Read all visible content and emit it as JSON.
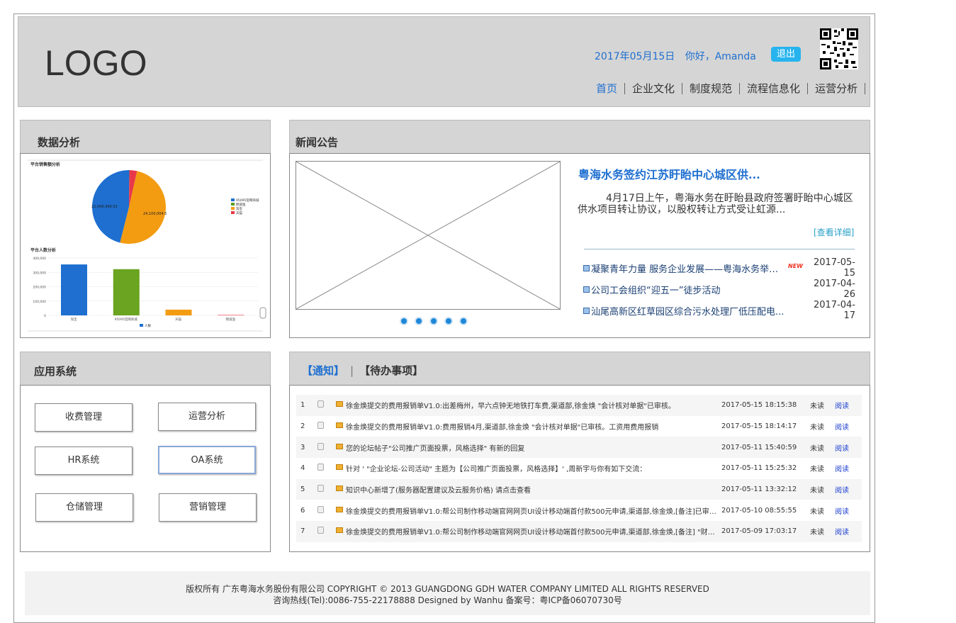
{
  "header": {
    "logo": "LOGO",
    "date": "2017年05月15日",
    "greeting": "你好，Amanda",
    "logout": "退出",
    "nav": [
      "首页",
      "企业文化",
      "制度规范",
      "流程信息化",
      "运营分析"
    ]
  },
  "data_panel": {
    "title": "数据分析",
    "pie": {
      "title": "平台销售额分析",
      "label_a": "22,099,999.53",
      "label_b": "24,100,004.5",
      "legend": [
        "95095官网商城",
        "明道渔",
        "淘宝",
        "天猫"
      ],
      "colors": [
        "#1e6fd0",
        "#5a9e1f",
        "#f39c12",
        "#e8394a"
      ]
    },
    "bar": {
      "title": "平台人数分析",
      "yticks": [
        "400,000",
        "300,000",
        "200,000",
        "100,000",
        "0"
      ],
      "categories": [
        "淘宝",
        "95095官网商城",
        "天猫",
        "明道渔"
      ],
      "legend": "人数"
    }
  },
  "chart_data": [
    {
      "type": "pie",
      "title": "平台销售额分析",
      "labels": [
        "95095官网商城",
        "明道渔",
        "淘宝",
        "天猫"
      ],
      "values": [
        22099999.53,
        0,
        24100004.5,
        1600000
      ]
    },
    {
      "type": "bar",
      "title": "平台人数分析",
      "categories": [
        "淘宝",
        "95095官网商城",
        "天猫",
        "明道渔"
      ],
      "values": [
        355000,
        322000,
        40000,
        3000
      ],
      "ylim": [
        0,
        400000
      ],
      "legend": [
        "人数"
      ]
    }
  ],
  "news": {
    "title": "新闻公告",
    "headline": "粤海水务签约江苏盱眙中心城区供...",
    "summary": "4月17日上午，粤海水务在盱眙县政府签署盱眙中心城区供水项目转让协议，以股权转让方式受让虹源...",
    "more": "[查看详细]",
    "items": [
      {
        "text": "凝聚青年力量 服务企业发展——粤海水务举办“...",
        "badge": "NEW",
        "date": "2017-05-15"
      },
      {
        "text": "公司工会组织“迎五一”徒步活动",
        "badge": "",
        "date": "2017-04-26"
      },
      {
        "text": "汕尾高新区红草园区综合污水处理厂低压配电...",
        "badge": "",
        "date": "2017-04-17"
      }
    ]
  },
  "apps": {
    "title": "应用系统",
    "buttons": [
      "收费管理",
      "运营分析",
      "HR系统",
      "OA系统",
      "仓储管理",
      "营销管理"
    ]
  },
  "notices": {
    "tab_notice": "【通知】",
    "tab_todo": "【待办事项】",
    "rows": [
      {
        "no": "1",
        "title": "徐金焕提交的费用报销单V1.0:出差梅州，早六点钟无地铁打车费,渠道部,徐金焕 \"会计核对单据\"已审核。",
        "time": "2017-05-15 18:15:38",
        "status": "未读",
        "action": "阅读"
      },
      {
        "no": "2",
        "title": "徐金焕提交的费用报销单V1.0:费用报销4月,渠道部,徐金焕 \"会计核对单据\"已审核。工资用费用报销",
        "time": "2017-05-15 18:14:17",
        "status": "未读",
        "action": "阅读"
      },
      {
        "no": "3",
        "title": "您的论坛帖子\"公司推广页面投票，风格选择\" 有新的回复",
        "time": "2017-05-11 15:40:59",
        "status": "未读",
        "action": "阅读"
      },
      {
        "no": "4",
        "title": "针对 ' \"企业论坛-公司活动\" 主题为【公司推广页面投票，风格选择】' ,周新宇与你有如下交流：",
        "time": "2017-05-11 15:25:32",
        "status": "未读",
        "action": "阅读"
      },
      {
        "no": "5",
        "title": "知识中心新增了(服务器配置建议及云服务价格) 请点击查看",
        "time": "2017-05-11 13:32:12",
        "status": "未读",
        "action": "阅读"
      },
      {
        "no": "6",
        "title": "徐金焕提交的费用报销单V1.0:帮公司制作移动端官网网页UI设计移动端首付款500元申请,渠道部,徐金焕,[备注]已审核完毕",
        "time": "2017-05-10 08:55:55",
        "status": "未读",
        "action": "阅读"
      },
      {
        "no": "7",
        "title": "徐金焕提交的费用报销单V1.0:帮公司制作移动端官网网页UI设计移动端首付款500元申请,渠道部,徐金焕,[备注] \"财务室打印单据\"已...",
        "time": "2017-05-09 17:03:17",
        "status": "未读",
        "action": "阅读"
      }
    ]
  },
  "footer": {
    "line1": "版权所有 广东粤海水务股份有限公司 COPYRIGHT © 2013 GUANGDONG GDH WATER COMPANY LIMITED ALL RIGHTS RESERVED",
    "line2": "咨询热线(Tel):0086-755-22178888 Designed by Wanhu  备案号：粤ICP备06070730号"
  }
}
